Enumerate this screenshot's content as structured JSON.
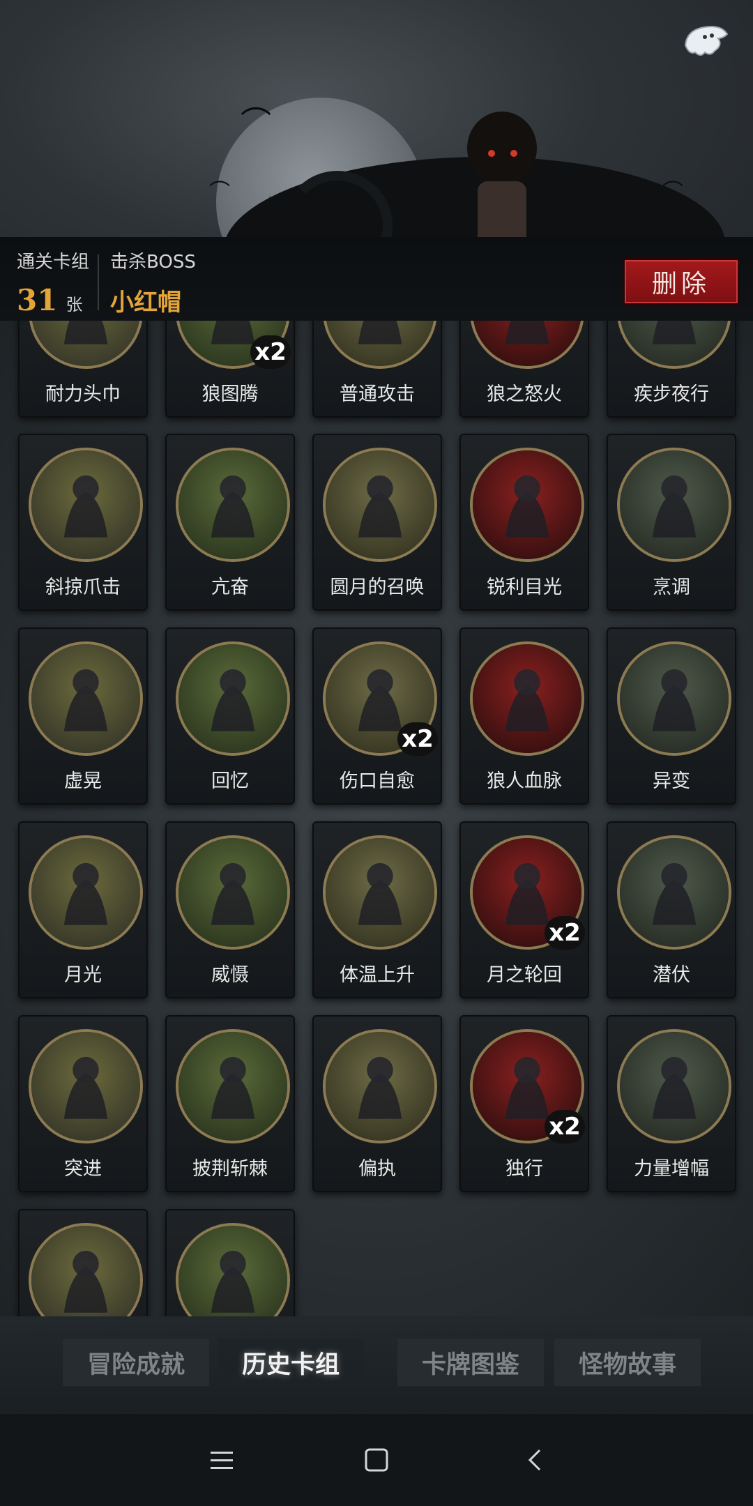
{
  "header": {
    "stats": {
      "cleared_deck_label": "通关卡组",
      "cleared_deck_count": "31",
      "cleared_deck_unit": "张",
      "boss_label": "击杀BOSS",
      "boss_name": "小红帽"
    },
    "delete_label": "删除"
  },
  "cards": [
    {
      "name": "耐力头巾",
      "mult": ""
    },
    {
      "name": "狼图腾",
      "mult": "x2"
    },
    {
      "name": "普通攻击",
      "mult": ""
    },
    {
      "name": "狼之怒火",
      "mult": ""
    },
    {
      "name": "疾步夜行",
      "mult": ""
    },
    {
      "name": "斜掠爪击",
      "mult": ""
    },
    {
      "name": "亢奋",
      "mult": ""
    },
    {
      "name": "圆月的召唤",
      "mult": ""
    },
    {
      "name": "锐利目光",
      "mult": ""
    },
    {
      "name": "烹调",
      "mult": ""
    },
    {
      "name": "虚晃",
      "mult": ""
    },
    {
      "name": "回忆",
      "mult": ""
    },
    {
      "name": "伤口自愈",
      "mult": "x2"
    },
    {
      "name": "狼人血脉",
      "mult": ""
    },
    {
      "name": "异变",
      "mult": ""
    },
    {
      "name": "月光",
      "mult": ""
    },
    {
      "name": "威慑",
      "mult": ""
    },
    {
      "name": "体温上升",
      "mult": ""
    },
    {
      "name": "月之轮回",
      "mult": "x2"
    },
    {
      "name": "潜伏",
      "mult": ""
    },
    {
      "name": "突进",
      "mult": ""
    },
    {
      "name": "披荆斩棘",
      "mult": ""
    },
    {
      "name": "偏执",
      "mult": ""
    },
    {
      "name": "独行",
      "mult": "x2"
    },
    {
      "name": "力量增幅",
      "mult": ""
    },
    {
      "name": "",
      "mult": ""
    },
    {
      "name": "",
      "mult": ""
    }
  ],
  "tabs": [
    {
      "label": "冒险成就",
      "active": false
    },
    {
      "label": "历史卡组",
      "active": true
    },
    {
      "label": "卡牌图鉴",
      "active": false
    },
    {
      "label": "怪物故事",
      "active": false
    }
  ],
  "colors": {
    "accent_gold": "#e3a43a",
    "delete_red": "#a4191c",
    "frame_gold": "#8c7a52"
  }
}
